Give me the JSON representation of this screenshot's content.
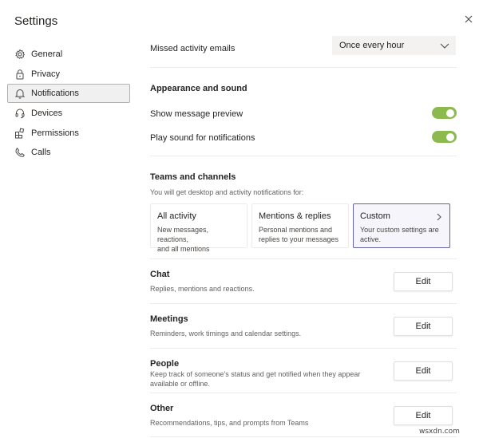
{
  "window": {
    "title": "Settings",
    "close_icon": "close-icon"
  },
  "sidebar": {
    "items": [
      {
        "label": "General",
        "icon": "gear-icon",
        "active": false
      },
      {
        "label": "Privacy",
        "icon": "lock-icon",
        "active": false
      },
      {
        "label": "Notifications",
        "icon": "bell-icon",
        "active": true
      },
      {
        "label": "Devices",
        "icon": "headset-icon",
        "active": false
      },
      {
        "label": "Permissions",
        "icon": "apps-icon",
        "active": false
      },
      {
        "label": "Calls",
        "icon": "phone-icon",
        "active": false
      }
    ]
  },
  "missed_activity": {
    "label": "Missed activity emails",
    "selected": "Once every hour"
  },
  "appearance": {
    "title": "Appearance and sound",
    "show_preview": {
      "label": "Show message preview",
      "on": true
    },
    "play_sound": {
      "label": "Play sound for notifications",
      "on": true
    },
    "toggle_color": "#8cba4f"
  },
  "teams_channels": {
    "title": "Teams and channels",
    "subtitle": "You will get desktop and activity notifications for:",
    "options": [
      {
        "title": "All activity",
        "desc_line1": "New messages, reactions,",
        "desc_line2": "and all mentions",
        "selected": false
      },
      {
        "title": "Mentions & replies",
        "desc_line1": "Personal mentions and",
        "desc_line2": "replies to your messages",
        "selected": false
      },
      {
        "title": "Custom",
        "desc_line1": "Your custom settings are",
        "desc_line2": "active.",
        "selected": true
      }
    ],
    "accent": "#6264a7"
  },
  "sections": [
    {
      "title": "Chat",
      "desc": "Replies, mentions and reactions.",
      "button": "Edit"
    },
    {
      "title": "Meetings",
      "desc": "Reminders, work timings and calendar settings.",
      "button": "Edit"
    },
    {
      "title": "People",
      "desc_line1": "Keep track of someone's status and get notified when they appear",
      "desc_line2": "available or offline.",
      "button": "Edit"
    },
    {
      "title": "Other",
      "desc": "Recommendations, tips, and prompts from Teams",
      "button": "Edit"
    }
  ],
  "watermark": "wsxdn.com"
}
